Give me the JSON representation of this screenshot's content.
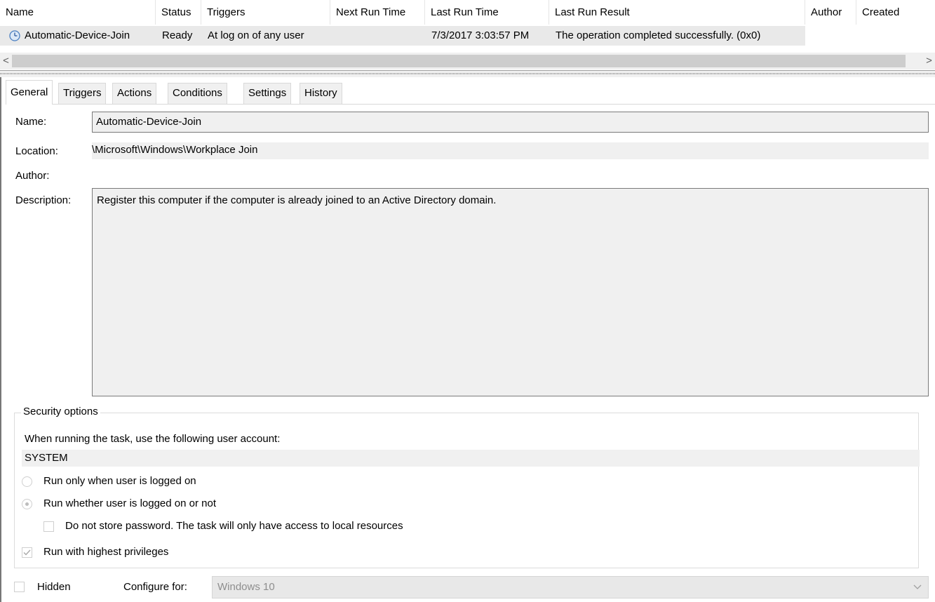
{
  "columns": [
    "Name",
    "Status",
    "Triggers",
    "Next Run Time",
    "Last Run Time",
    "Last Run Result",
    "Author",
    "Created"
  ],
  "task_row": {
    "name": "Automatic-Device-Join",
    "status": "Ready",
    "triggers": "At log on of any user",
    "next_run_time": "",
    "last_run_time": "7/3/2017 3:03:57 PM",
    "last_run_result": "The operation completed successfully. (0x0)",
    "author": "",
    "created": "",
    "icon": "clock-icon"
  },
  "scrollbar": {
    "left_arrow": "<",
    "right_arrow": ">"
  },
  "tabs": [
    {
      "label": "General",
      "active": true
    },
    {
      "label": "Triggers",
      "active": false
    },
    {
      "label": "Actions",
      "active": false
    },
    {
      "label": "Conditions",
      "active": false
    },
    {
      "label": "Settings",
      "active": false
    },
    {
      "label": "History",
      "active": false
    }
  ],
  "general": {
    "name_label": "Name:",
    "name_value": "Automatic-Device-Join",
    "location_label": "Location:",
    "location_value": "\\Microsoft\\Windows\\Workplace Join",
    "author_label": "Author:",
    "author_value": "",
    "description_label": "Description:",
    "description_value": "Register this computer if the computer is already joined to an Active Directory domain."
  },
  "security": {
    "title": "Security options",
    "account_prompt": "When running the task, use the following user account:",
    "account_value": "SYSTEM",
    "radio_logged_on": "Run only when user is logged on",
    "radio_whether": "Run whether user is logged on or not",
    "no_store_password": "Do not store password.  The task will only have access to local resources",
    "highest_privileges": "Run with highest privileges",
    "selected_option": "Run whether user is logged on or not",
    "highest_privileges_checked": true,
    "no_store_password_checked": false
  },
  "footer": {
    "hidden_label": "Hidden",
    "hidden_checked": false,
    "configure_label": "Configure for:",
    "configure_value": "Windows 10"
  },
  "colors": {
    "selected_row": "#e9e9e9",
    "readonly_field": "#f0f0f0",
    "disabled_text": "#8e8e8e"
  }
}
